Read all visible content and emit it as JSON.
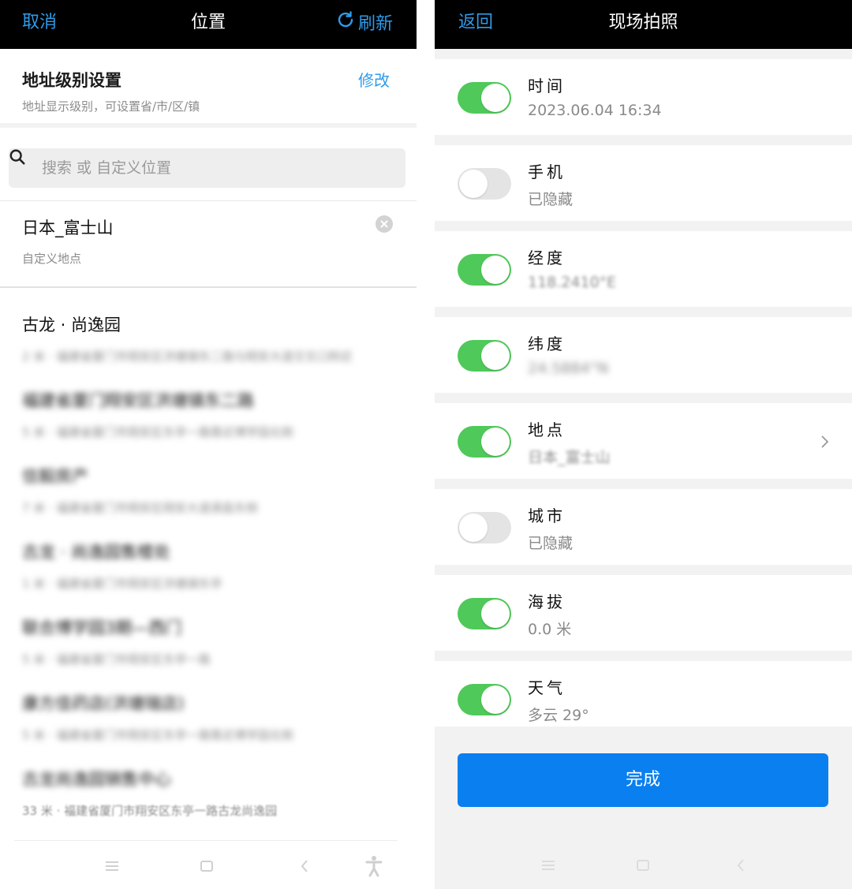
{
  "left": {
    "header": {
      "cancel": "取消",
      "title": "位置",
      "refresh": "刷新"
    },
    "level": {
      "title": "地址级别设置",
      "subtitle": "地址显示级别，可设置省/市/区/镇",
      "edit": "修改"
    },
    "search": {
      "placeholder": "搜索 或 自定义位置"
    },
    "custom": {
      "name": "日本_富士山",
      "desc": "自定义地点"
    },
    "items": [
      {
        "name": "古龙 · 尚逸园",
        "desc": "2 米 · 福建省厦门市翔安区洪塘镇东二路与翔安大道交叉口附近"
      },
      {
        "name": "福建省厦门翔安区洪塘镇东二路",
        "desc": "5 米 · 福建省厦门市翔安区东亭一路靠近博学园北侧"
      },
      {
        "name": "信毅房产",
        "desc": "7 米 · 福建省厦门市翔安区翔安大道源昌东侧"
      },
      {
        "name": "古龙 · 尚逸园售楼处",
        "desc": "1 米 · 福建省厦门市翔安区洪塘镇东亭"
      },
      {
        "name": "联合博学园3期—西门",
        "desc": "5 米 · 福建省厦门市翔安区东亭一路"
      },
      {
        "name": "康方佳药店(洪塘瑞店)",
        "desc": "5 米 · 福建省厦门市翔安区东亭一路靠近博学园北侧"
      },
      {
        "name": "古龙尚逸园销售中心",
        "desc": "33 米 · 福建省厦门市翔安区东亭一路古龙尚逸园"
      }
    ]
  },
  "right": {
    "header": {
      "back": "返回",
      "title": "现场拍照"
    },
    "fields": [
      {
        "label": "时间",
        "value": "2023.06.04 16:34",
        "on": true
      },
      {
        "label": "手机",
        "value": "已隐藏",
        "on": false
      },
      {
        "label": "经度",
        "value": "118.2410°E",
        "on": true
      },
      {
        "label": "纬度",
        "value": "24.5884°N",
        "on": true
      },
      {
        "label": "地点",
        "value": "日本_富士山",
        "on": true
      },
      {
        "label": "城市",
        "value": "已隐藏",
        "on": false
      },
      {
        "label": "海拔",
        "value": "0.0 米",
        "on": true
      },
      {
        "label": "天气",
        "value": "多云 29°",
        "on": true
      }
    ],
    "done": "完成"
  },
  "icons": {
    "refresh": "refresh-icon",
    "search": "search-icon",
    "clear": "clear-icon",
    "chevron": "chevron-right-icon"
  },
  "colors": {
    "accent": "#2f9bea",
    "toggle_on": "#4fc95a",
    "button": "#0a7ff0"
  }
}
